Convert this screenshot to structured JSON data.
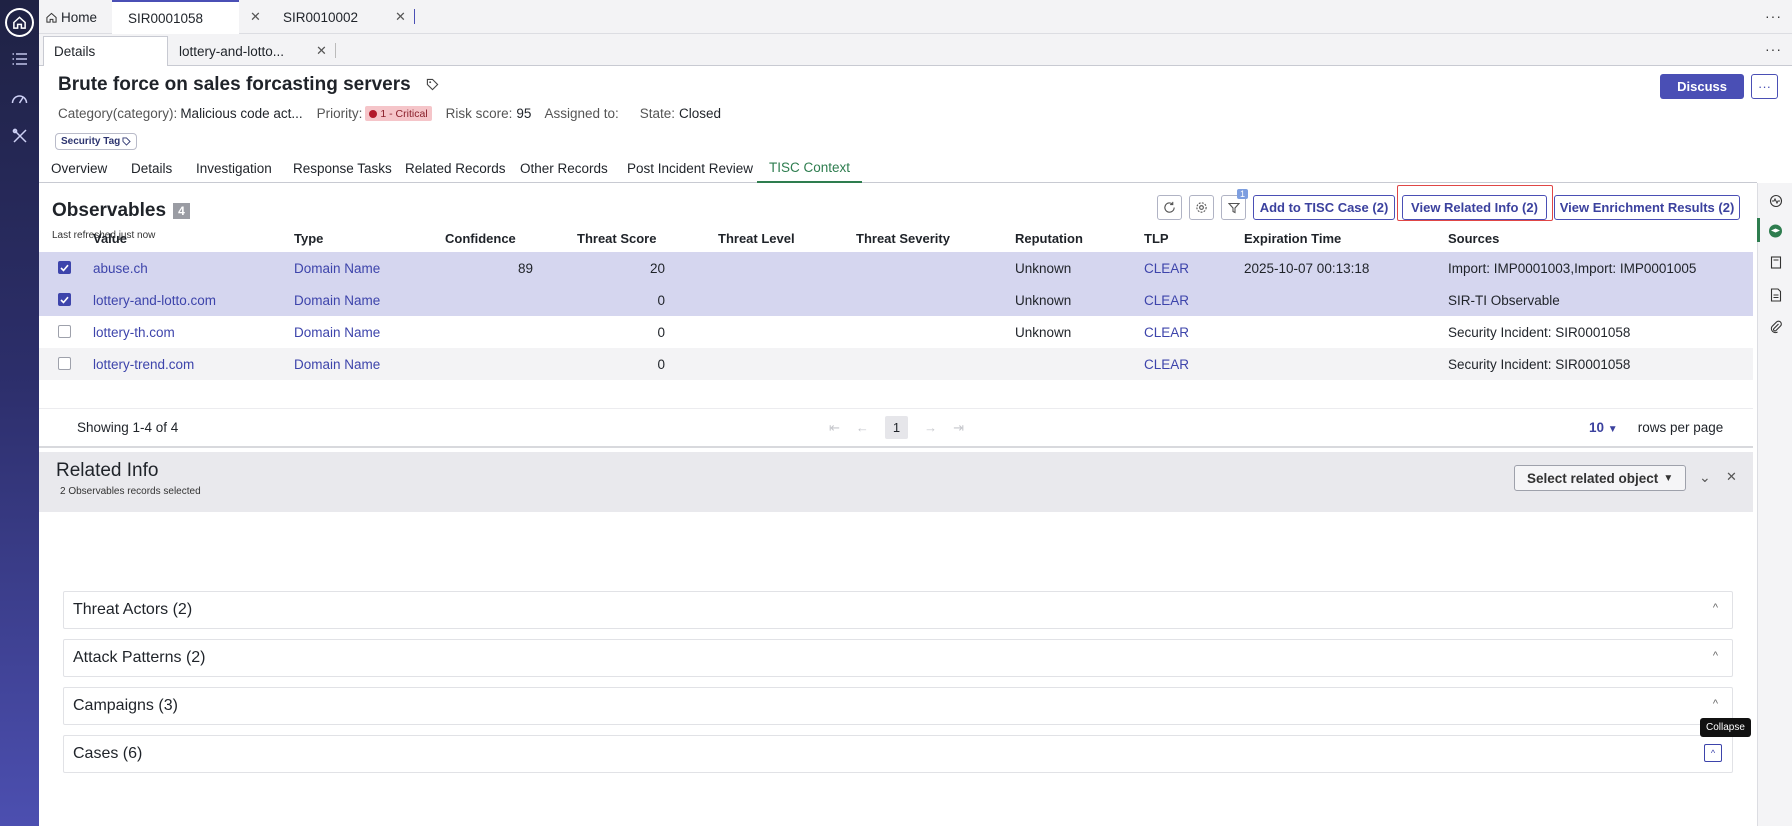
{
  "tabs": [
    {
      "label": "Home"
    },
    {
      "label": "SIR0001058"
    },
    {
      "label": "SIR0010002"
    }
  ],
  "subtabs": [
    {
      "label": "Details"
    },
    {
      "label": "lottery-and-lotto..."
    }
  ],
  "record": {
    "title": "Brute force on sales forcasting servers",
    "category_label": "Category(category):",
    "category_value": "Malicious code act...",
    "priority_label": "Priority:",
    "priority_value": "1 - Critical",
    "risk_label": "Risk score:",
    "risk_value": "95",
    "assigned_label": "Assigned to:",
    "state_label": "State:",
    "state_value": "Closed",
    "tag": "Security Tag",
    "discuss": "Discuss"
  },
  "nav_tabs": [
    "Overview",
    "Details",
    "Investigation",
    "Response Tasks",
    "Related Records",
    "Other Records",
    "Post Incident Review",
    "TISC Context"
  ],
  "observables": {
    "title": "Observables",
    "count": "4",
    "refreshed": "Last refreshed just now",
    "filter_badge": "1",
    "btn_add": "Add to TISC Case (2)",
    "btn_related": "View Related Info (2)",
    "btn_enrich": "View Enrichment Results (2)",
    "columns": [
      "Value",
      "Type",
      "Confidence",
      "Threat Score",
      "Threat Level",
      "Threat Severity",
      "Reputation",
      "TLP",
      "Expiration Time",
      "Sources"
    ],
    "rows": [
      {
        "checked": true,
        "value": "abuse.ch",
        "type": "Domain Name",
        "confidence": "89",
        "threat_score": "20",
        "reputation": "Unknown",
        "tlp": "CLEAR",
        "expiration": "2025-10-07 00:13:18",
        "sources": "Import: IMP0001003,Import: IMP0001005"
      },
      {
        "checked": true,
        "value": "lottery-and-lotto.com",
        "type": "Domain Name",
        "confidence": "",
        "threat_score": "0",
        "reputation": "Unknown",
        "tlp": "CLEAR",
        "expiration": "",
        "sources": "SIR-TI Observable"
      },
      {
        "checked": false,
        "value": "lottery-th.com",
        "type": "Domain Name",
        "confidence": "",
        "threat_score": "0",
        "reputation": "Unknown",
        "tlp": "CLEAR",
        "expiration": "",
        "sources": "Security Incident: SIR0001058"
      },
      {
        "checked": false,
        "value": "lottery-trend.com",
        "type": "Domain Name",
        "confidence": "",
        "threat_score": "0",
        "reputation": "",
        "tlp": "CLEAR",
        "expiration": "",
        "sources": "Security Incident: SIR0001058"
      }
    ],
    "showing": "Showing 1-4 of 4",
    "page": "1",
    "rows_per_page_value": "10",
    "rows_per_page_label": "rows per page"
  },
  "related": {
    "title": "Related Info",
    "subtitle": "2 Observables records selected",
    "select_label": "Select related object",
    "sections": [
      "Threat Actors (2)",
      "Attack Patterns (2)",
      "Campaigns (3)",
      "Cases (6)"
    ],
    "tooltip": "Collapse"
  },
  "colors": {
    "accent": "#4a4fb5",
    "active_tab": "#2e7d4f",
    "selected_row": "#d5d6ef",
    "highlight": "#e04646"
  }
}
